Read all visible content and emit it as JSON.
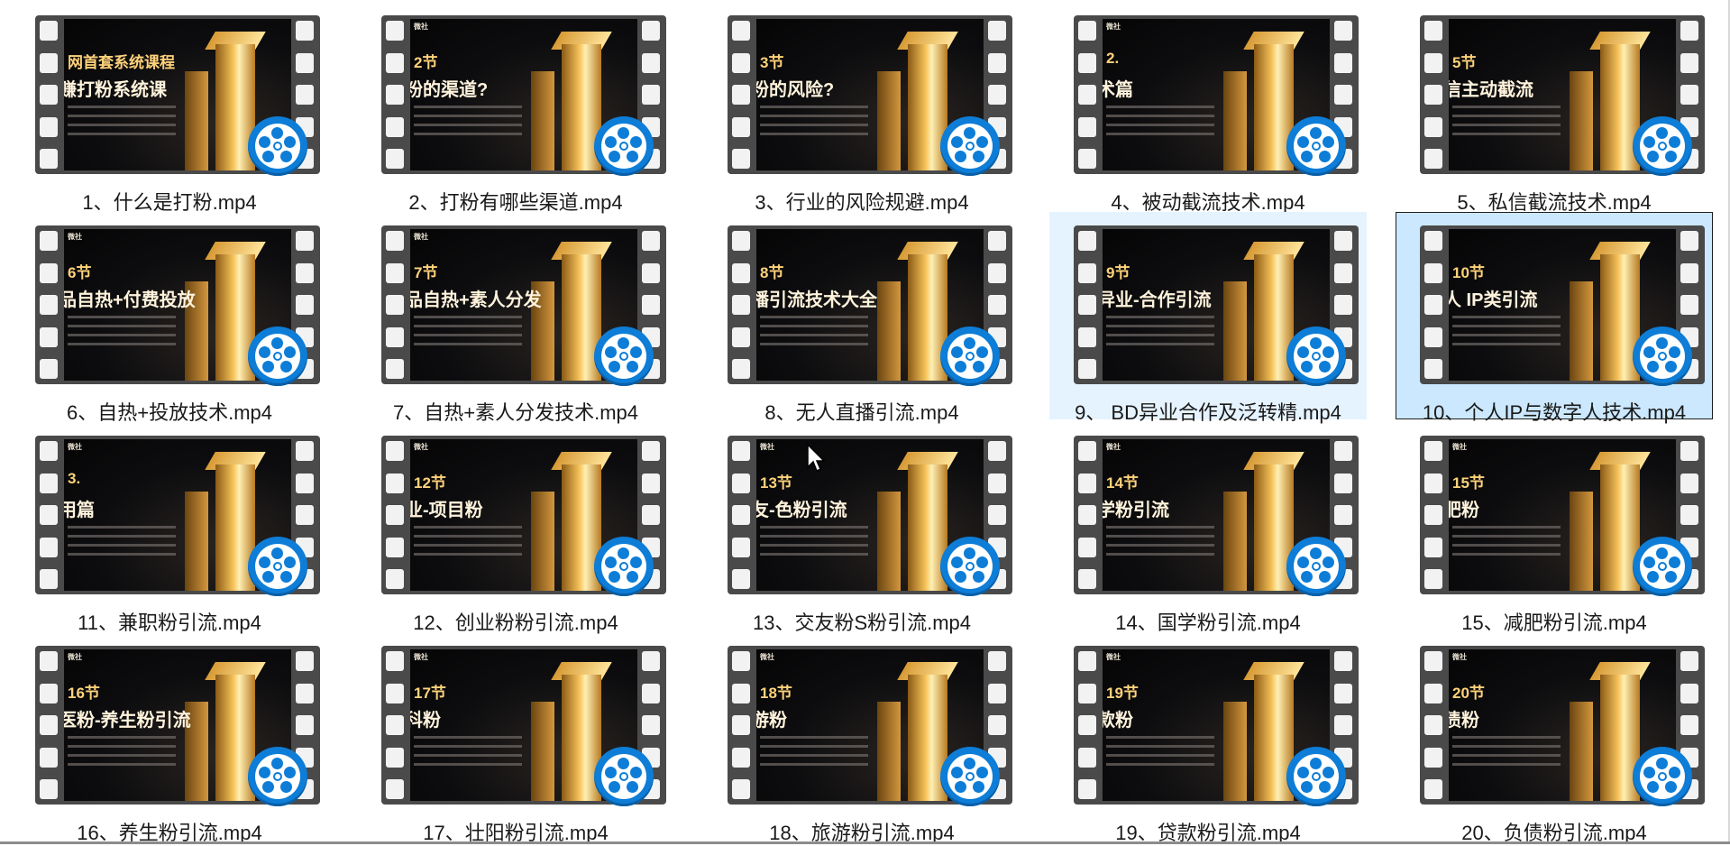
{
  "files": [
    {
      "name": "1、什么是打粉.mp4",
      "brand": "",
      "section": "网首套系统课程",
      "headline": "赚打粉系统课"
    },
    {
      "name": "2、打粉有哪些渠道.mp4",
      "brand": "微社",
      "section": "2节",
      "headline": "粉的渠道?"
    },
    {
      "name": "3、行业的风险规避.mp4",
      "brand": "",
      "section": "3节",
      "headline": "粉的风险?"
    },
    {
      "name": "4、被动截流技术.mp4",
      "brand": "微社",
      "section": "2.",
      "headline": "术篇"
    },
    {
      "name": "5、私信截流技术.mp4",
      "brand": "",
      "section": "5节",
      "headline": "信主动截流"
    },
    {
      "name": "6、自热+投放技术.mp4",
      "brand": "微社",
      "section": "6节",
      "headline": "品自热+付费投放"
    },
    {
      "name": "7、自热+素人分发技术.mp4",
      "brand": "微社",
      "section": "7节",
      "headline": "品自热+素人分发"
    },
    {
      "name": "8、无人直播引流.mp4",
      "brand": "",
      "section": "8节",
      "headline": "播引流技术大全"
    },
    {
      "name": "9、 BD异业合作及泛转精.mp4",
      "brand": "",
      "section": "9节",
      "headline": "异业-合作引流"
    },
    {
      "name": "10、个人IP与数字人技术.mp4",
      "brand": "",
      "section": "10节",
      "headline": "人 IP类引流"
    },
    {
      "name": "11、兼职粉引流.mp4",
      "brand": "微社",
      "section": "3.",
      "headline": "用篇"
    },
    {
      "name": "12、创业粉粉引流.mp4",
      "brand": "微社",
      "section": "12节",
      "headline": "业-项目粉"
    },
    {
      "name": "13、交友粉S粉引流.mp4",
      "brand": "微社",
      "section": "13节",
      "headline": "友-色粉引流"
    },
    {
      "name": "14、国学粉引流.mp4",
      "brand": "微社",
      "section": "14节",
      "headline": "学粉引流"
    },
    {
      "name": "15、减肥粉引流.mp4",
      "brand": "微社",
      "section": "15节",
      "headline": "肥粉"
    },
    {
      "name": "16、养生粉引流.mp4",
      "brand": "微社",
      "section": "16节",
      "headline": "医粉-养生粉引流"
    },
    {
      "name": "17、壮阳粉引流.mp4",
      "brand": "微社",
      "section": "17节",
      "headline": "科粉"
    },
    {
      "name": "18、旅游粉引流.mp4",
      "brand": "微社",
      "section": "18节",
      "headline": "游粉"
    },
    {
      "name": "19、贷款粉引流.mp4",
      "brand": "微社",
      "section": "19节",
      "headline": "款粉"
    },
    {
      "name": "20、负债粉引流.mp4",
      "brand": "微社",
      "section": "20节",
      "headline": "债粉"
    }
  ],
  "hovered_index": 8,
  "selected_index": 9,
  "colors": {
    "accent": "#0d7dd7",
    "hover_bg": "#e5f3ff",
    "selected_bg": "#cce8ff"
  },
  "icons": {
    "file_type": "video-player-icon",
    "cursor": "mouse-pointer-icon"
  }
}
